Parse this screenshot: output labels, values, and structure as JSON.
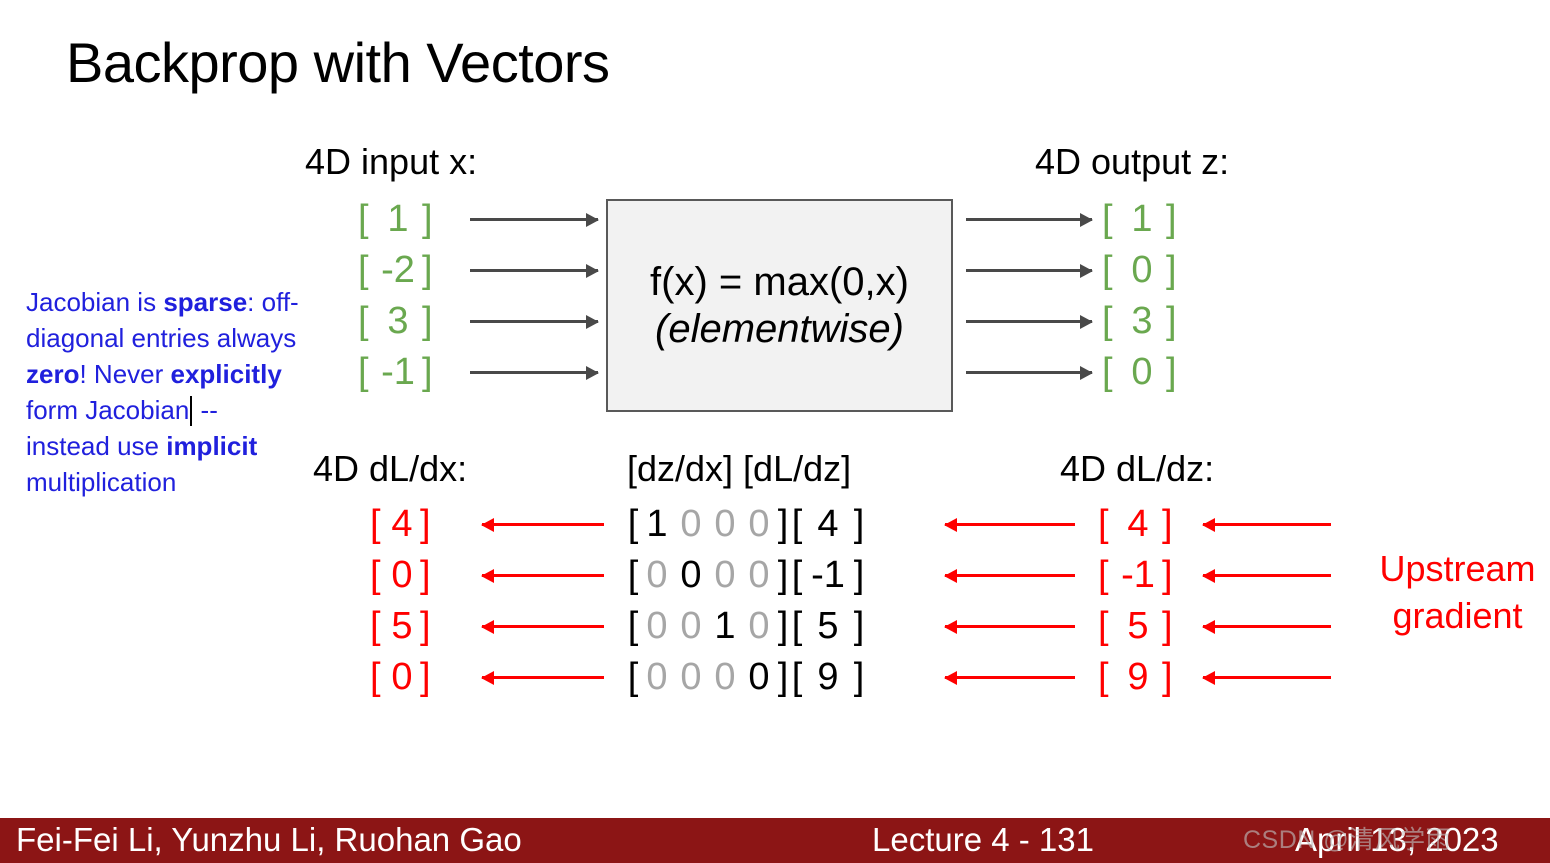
{
  "slide": {
    "title": "Backprop with Vectors"
  },
  "note": {
    "segments": [
      {
        "text": "Jacobian is ",
        "bold": false
      },
      {
        "text": "sparse",
        "bold": true
      },
      {
        "text": ": off-diagonal entries always ",
        "bold": false
      },
      {
        "text": "zero",
        "bold": true
      },
      {
        "text": "! Never ",
        "bold": false
      },
      {
        "text": "explicitly",
        "bold": true
      },
      {
        "text": " form Jacobian",
        "bold": false
      },
      {
        "text": " -- instead use ",
        "bold": false
      },
      {
        "text": "implicit",
        "bold": true
      },
      {
        "text": " multiplication",
        "bold": false
      }
    ],
    "full_text": "Jacobian is sparse: off-diagonal entries always zero! Never explicitly form Jacobian -- instead use implicit multiplication",
    "color": "#2020dd",
    "caret_after": "Jacobian"
  },
  "forward": {
    "input_label": "4D input x:",
    "output_label": "4D output z:",
    "input_values": [
      "1",
      "-2",
      "3",
      "-1"
    ],
    "output_values": [
      "1",
      "0",
      "3",
      "0"
    ],
    "vector_color": "#6aa84f",
    "bracket_open": "[",
    "bracket_close": "]",
    "function_box": {
      "line1": "f(x) = max(0,x)",
      "line2": "(elementwise)",
      "fill": "#f2f2f2",
      "border": "#595959"
    },
    "arrow_color": "#494949"
  },
  "backward": {
    "dldx_label": "4D dL/dx:",
    "jacobian_label": "[dz/dx] [dL/dz]",
    "dldz_label": "4D dL/dz:",
    "dldx_values": [
      "4",
      "0",
      "5",
      "0"
    ],
    "jacobian_rows": [
      [
        "1",
        "0",
        "0",
        "0"
      ],
      [
        "0",
        "0",
        "0",
        "0"
      ],
      [
        "0",
        "0",
        "1",
        "0"
      ],
      [
        "0",
        "0",
        "0",
        "0"
      ]
    ],
    "jacobian_diagonal_index": [
      0,
      1,
      2,
      3
    ],
    "dldz_values": [
      "4",
      "-1",
      "5",
      "9"
    ],
    "upstream_values": [
      "4",
      "-1",
      "5",
      "9"
    ],
    "upstream_label_line1": "Upstream",
    "upstream_label_line2": "gradient",
    "gradient_color": "#ff0000",
    "diagonal_color": "#000000",
    "offdiagonal_color": "#a6a6a6",
    "bracket_open": "[",
    "bracket_close": "]"
  },
  "footer": {
    "authors": "Fei-Fei Li, Yunzhu Li, Ruohan Gao",
    "lecture": "Lecture 4 - 131",
    "date": "April 13, 2023",
    "bar_color": "#8c1515"
  },
  "watermark": {
    "text": "CSDN @清风学雨"
  }
}
